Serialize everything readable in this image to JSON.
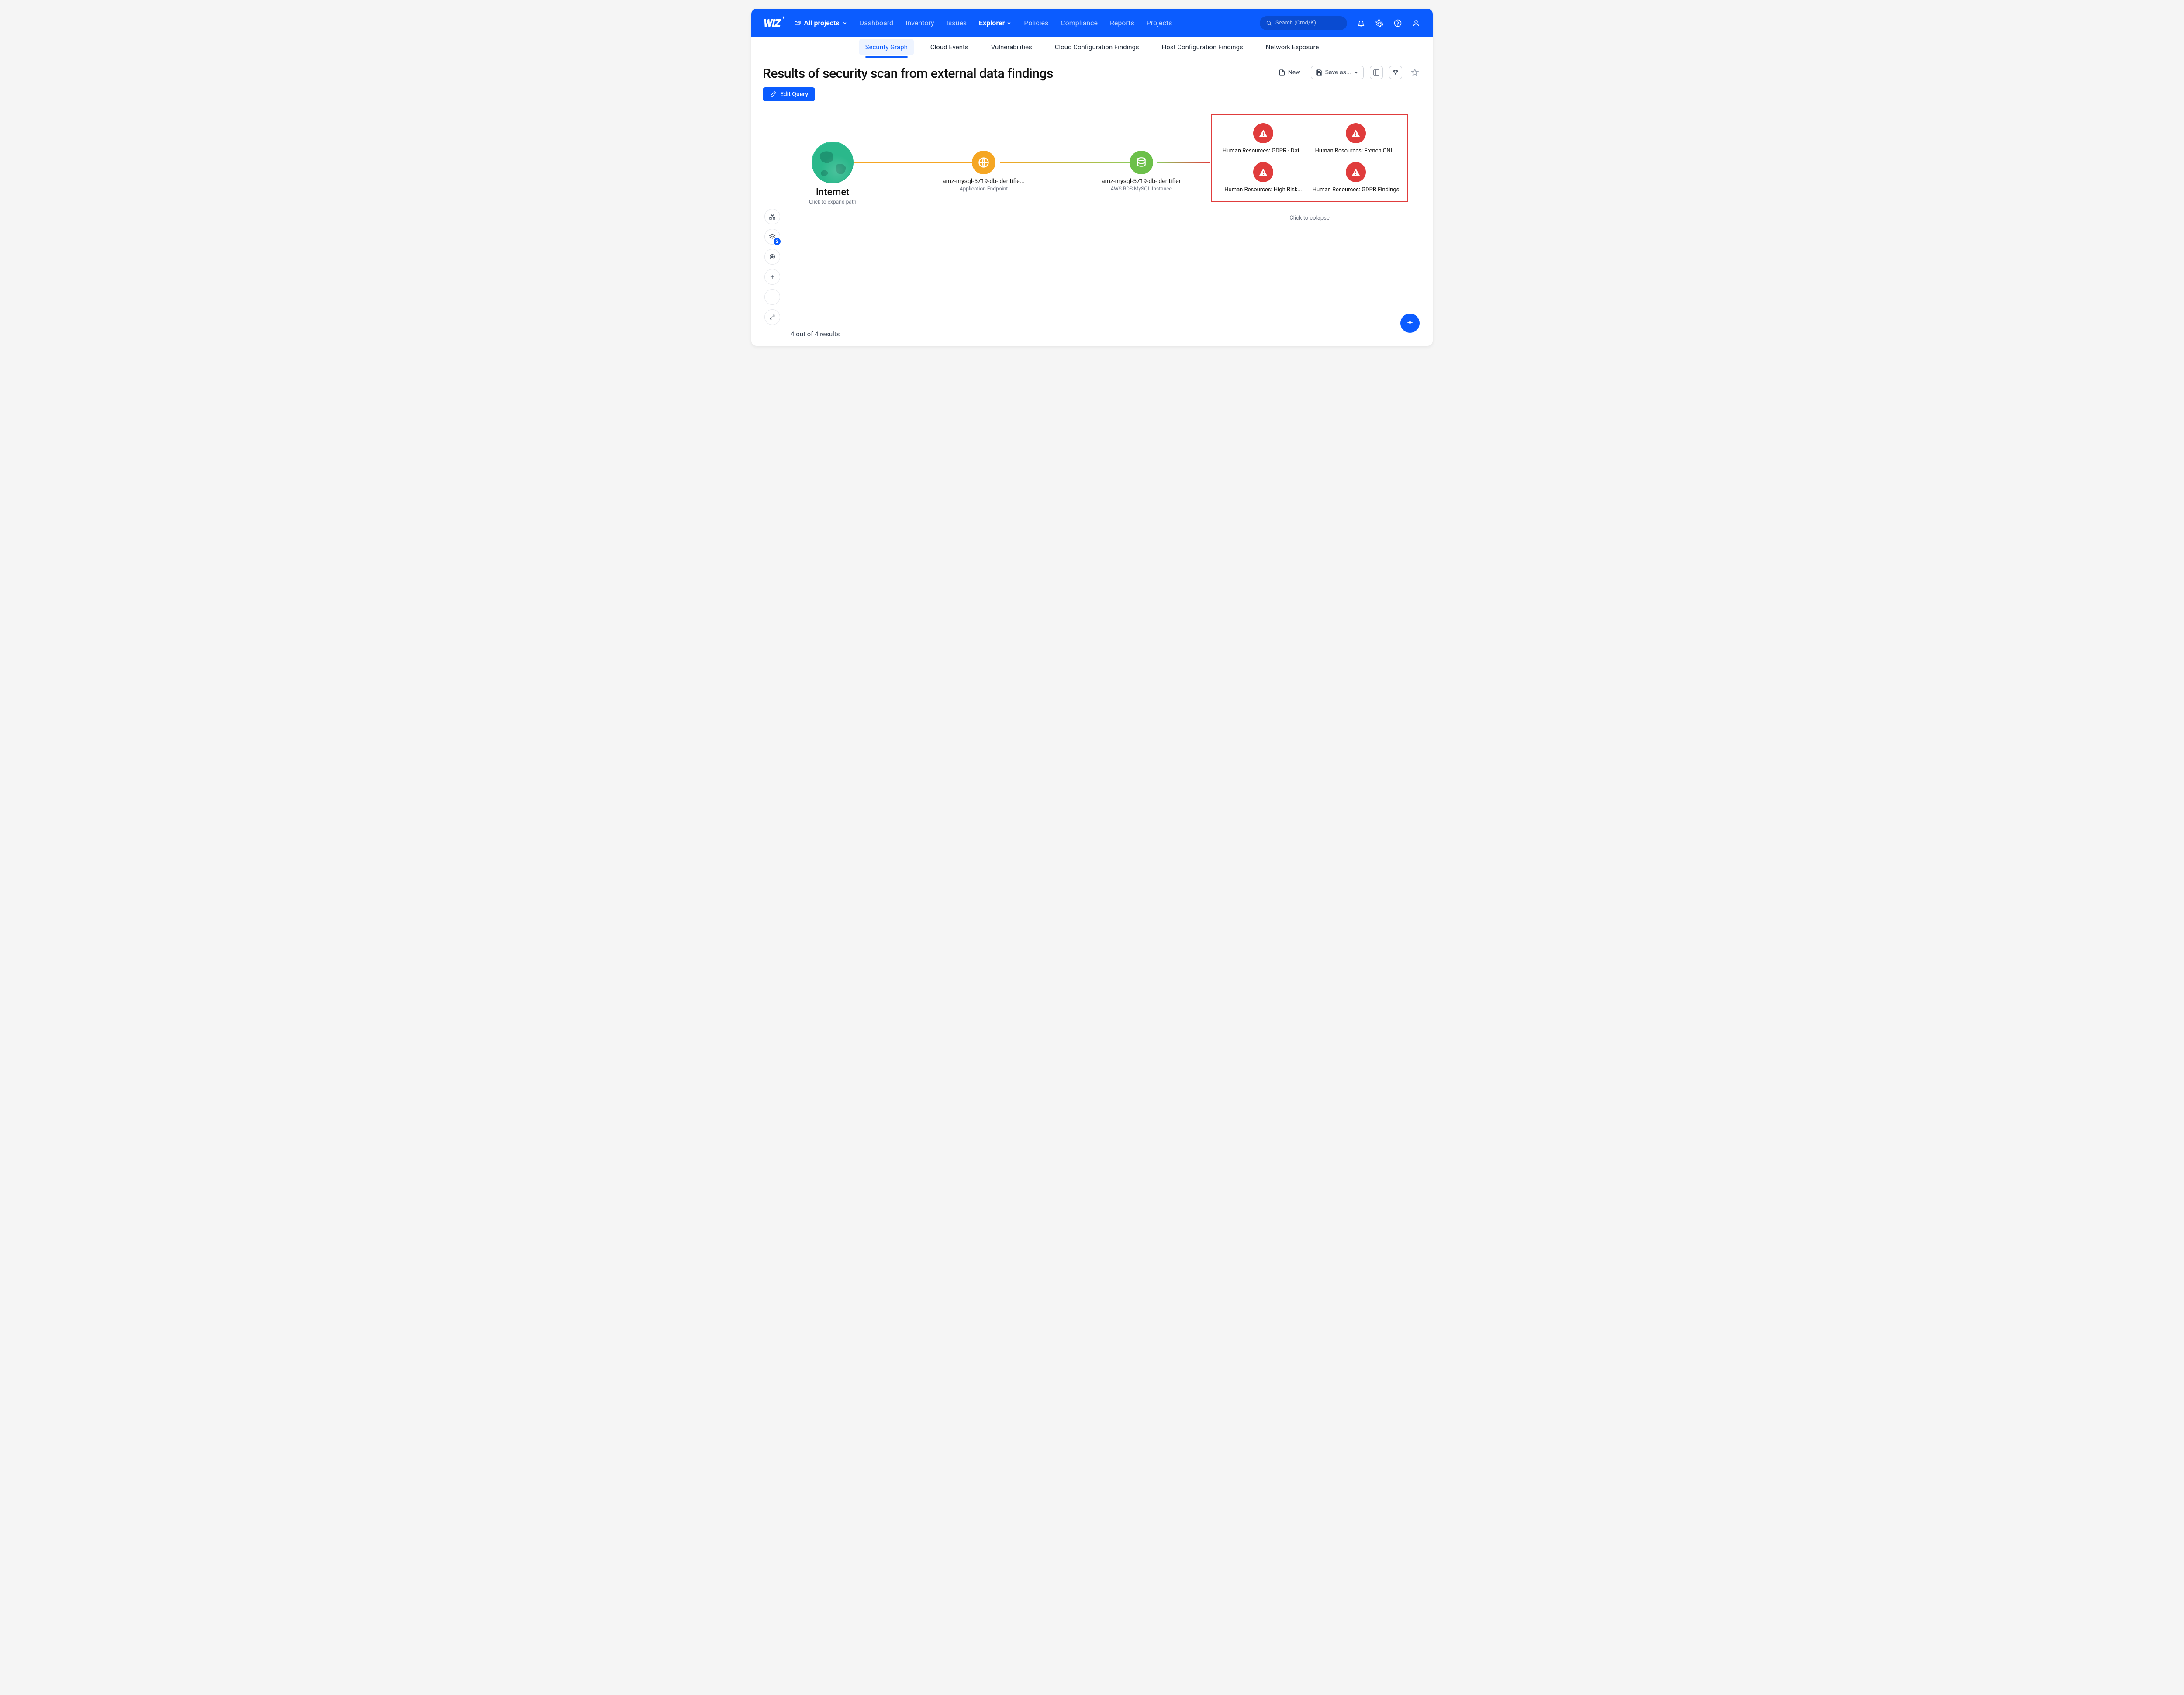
{
  "brand": "WIZ",
  "project_picker": "All projects",
  "nav": {
    "items": [
      "Dashboard",
      "Inventory",
      "Issues",
      "Explorer",
      "Policies",
      "Compliance",
      "Reports",
      "Projects"
    ],
    "active_index": 3
  },
  "search": {
    "placeholder": "Search (Cmd/K)"
  },
  "subtabs": {
    "items": [
      "Security Graph",
      "Cloud Events",
      "Vulnerabilities",
      "Cloud Configuration Findings",
      "Host Configuration Findings",
      "Network Exposure"
    ],
    "active_index": 0
  },
  "page": {
    "title": "Results of security scan from external data findings",
    "actions": {
      "new": "New",
      "save_as": "Save as..."
    },
    "edit_query": "Edit Query",
    "results_count": "4 out of 4 results"
  },
  "side_controls": {
    "layers_badge": "2"
  },
  "graph": {
    "internet": {
      "label": "Internet",
      "sublabel": "Click to expand path"
    },
    "endpoint": {
      "label": "amz-mysql-5719-db-identifie...",
      "sublabel": "Application Endpoint"
    },
    "db": {
      "label": "amz-mysql-5719-db-identifier",
      "sublabel": "AWS RDS MySQL Instance"
    }
  },
  "findings": {
    "items": [
      "Human Resources: GDPR - Dat...",
      "Human Resources: French CNI...",
      "Human Resources: High Risk...",
      "Human Resources: GDPR Findings"
    ],
    "collapse_hint": "Click to colapse"
  }
}
